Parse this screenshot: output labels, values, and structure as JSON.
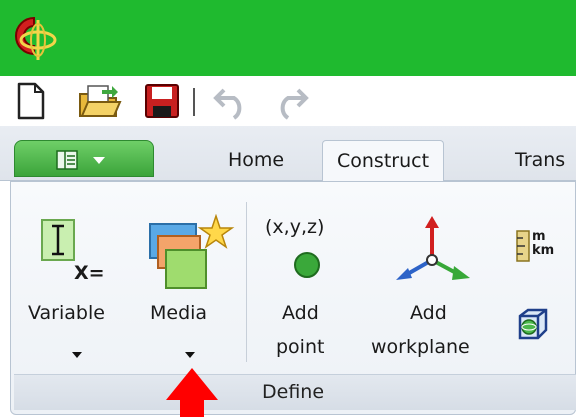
{
  "ribbon_tabs": [
    {
      "label": "Home"
    },
    {
      "label": "Construct"
    },
    {
      "label": "Trans"
    }
  ],
  "active_tab": "Construct",
  "buttons": {
    "variable": {
      "label": "Variable",
      "icon": "variable-icon",
      "icon_text": "X="
    },
    "media": {
      "label": "Media",
      "icon": "media-icon"
    },
    "add_point": {
      "label_line1": "Add",
      "label_line2": "point",
      "icon": "add-point-icon",
      "icon_text": "(x,y,z)"
    },
    "add_workplane": {
      "label_line1": "Add",
      "label_line2": "workplane",
      "icon": "workplane-axes-icon"
    },
    "units": {
      "icon": "units-icon",
      "icon_text_top": "m",
      "icon_text_bottom": "km"
    },
    "bounding_box": {
      "icon": "bounding-box-icon"
    }
  },
  "group": {
    "label": "Define"
  },
  "colors": {
    "title_bar": "#1fba2f",
    "file_menu": "#4caf4a",
    "annotation_arrow": "#ff0000"
  }
}
